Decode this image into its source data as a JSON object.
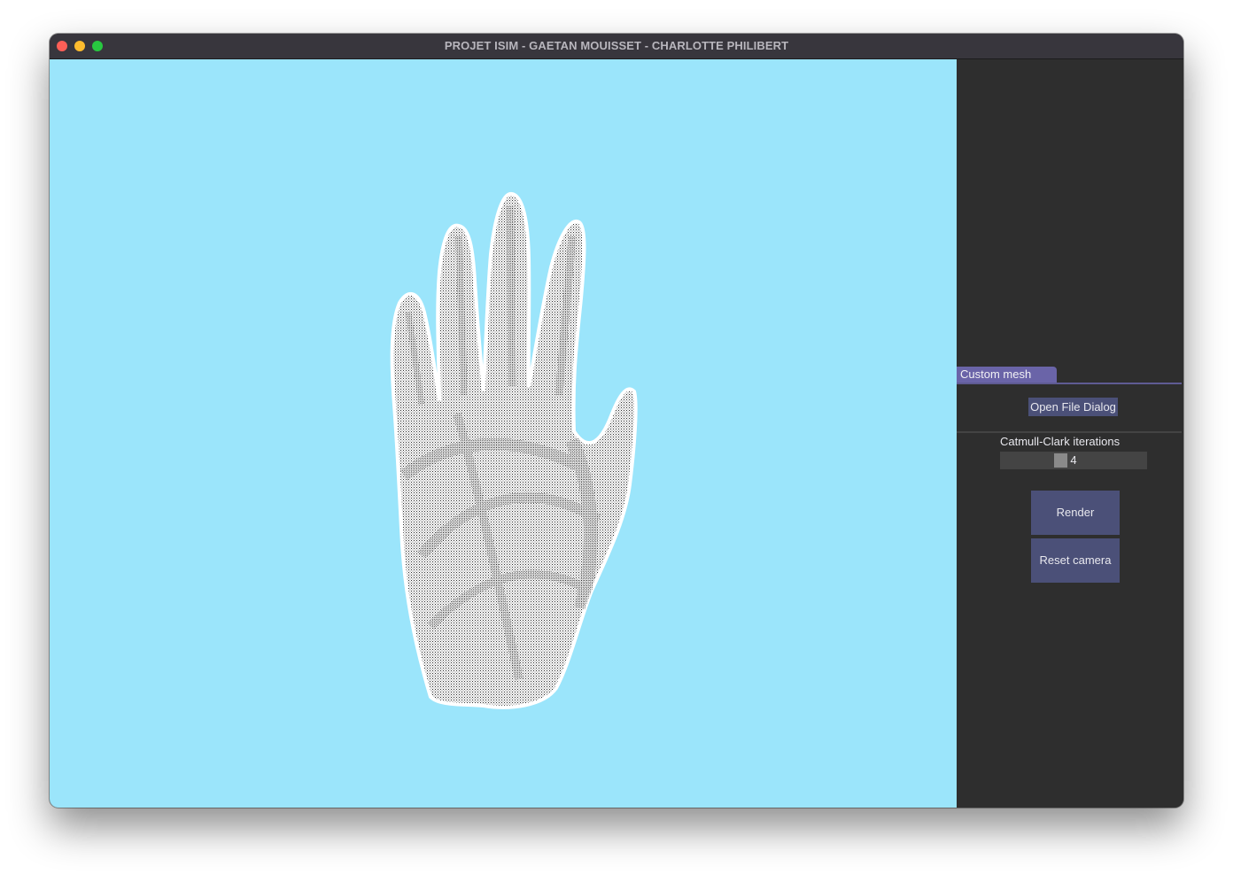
{
  "window": {
    "title": "PROJET ISIM - GAETAN MOUISSET - CHARLOTTE PHILIBERT"
  },
  "viewport": {
    "background_color": "#9be5fb",
    "mesh_color": "#ffffff",
    "mesh_detail_color": "#2a2a2a",
    "model": "hand-mesh"
  },
  "panel": {
    "tab_label": "Custom mesh",
    "open_file_label": "Open File Dialog",
    "slider_label": "Catmull-Clark iterations",
    "slider_value": "4",
    "render_label": "Render",
    "reset_camera_label": "Reset camera"
  },
  "colors": {
    "panel_bg": "#2e2e2e",
    "button_bg": "#4b5078",
    "tab_bg": "#6a64a8",
    "close": "#fe5f57",
    "minimize": "#febc2e",
    "zoom": "#28c840"
  }
}
